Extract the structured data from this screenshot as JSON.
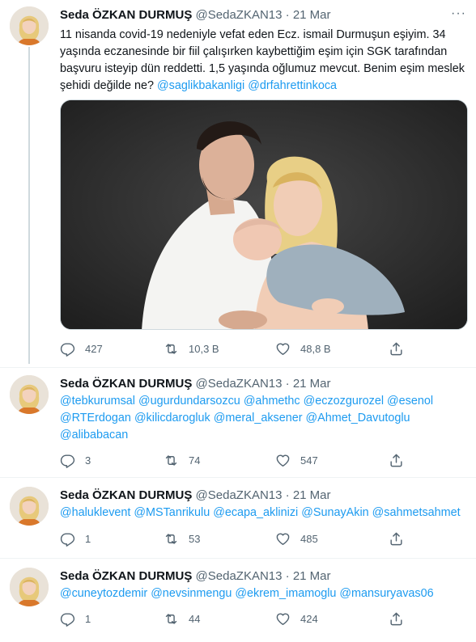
{
  "tweets": [
    {
      "name": "Seda ÖZKAN DURMUŞ",
      "handle": "@SedaZKAN13",
      "separator": "·",
      "date": "21 Mar",
      "more": "···",
      "text_plain": "11 nisanda covid-19 nedeniyle vefat eden Ecz. ismail Durmuşun eşiyim. 34 yaşında eczanesinde bir fiil çalışırken kaybettiğim eşim için SGK tarafından başvuru isteyip dün reddetti. 1,5 yaşında oğlumuz mevcut. Benim eşim meslek şehidi değilde ne?",
      "mentions": [
        "@saglikbakanligi",
        "@drfahrettinkoca"
      ],
      "replies": "427",
      "retweets": "10,3 B",
      "likes": "48,8 B"
    },
    {
      "name": "Seda ÖZKAN DURMUŞ",
      "handle": "@SedaZKAN13",
      "separator": "·",
      "date": "21 Mar",
      "mentions": [
        "@tebkurumsal",
        "@ugurdundarsozcu",
        "@ahmethc",
        "@eczozgurozel",
        "@esenol",
        "@RTErdogan",
        "@kilicdarogluk",
        "@meral_aksener",
        "@Ahmet_Davutoglu",
        "@alibabacan"
      ],
      "replies": "3",
      "retweets": "74",
      "likes": "547"
    },
    {
      "name": "Seda ÖZKAN DURMUŞ",
      "handle": "@SedaZKAN13",
      "separator": "·",
      "date": "21 Mar",
      "mentions": [
        "@haluklevent",
        "@MSTanrikulu",
        "@ecapa_aklinizi",
        "@SunayAkin",
        "@sahmetsahmet"
      ],
      "replies": "1",
      "retweets": "53",
      "likes": "485"
    },
    {
      "name": "Seda ÖZKAN DURMUŞ",
      "handle": "@SedaZKAN13",
      "separator": "·",
      "date": "21 Mar",
      "mentions": [
        "@cuneytozdemir",
        "@nevsinmengu",
        "@ekrem_imamoglu",
        "@mansuryavas06"
      ],
      "replies": "1",
      "retweets": "44",
      "likes": "424"
    }
  ],
  "colors": {
    "accent": "#1d9bf0",
    "secondary_text": "#536471",
    "divider": "#eff3f4"
  },
  "icons": {
    "reply": "reply-icon",
    "retweet": "retweet-icon",
    "like": "heart-icon",
    "share": "share-icon"
  }
}
